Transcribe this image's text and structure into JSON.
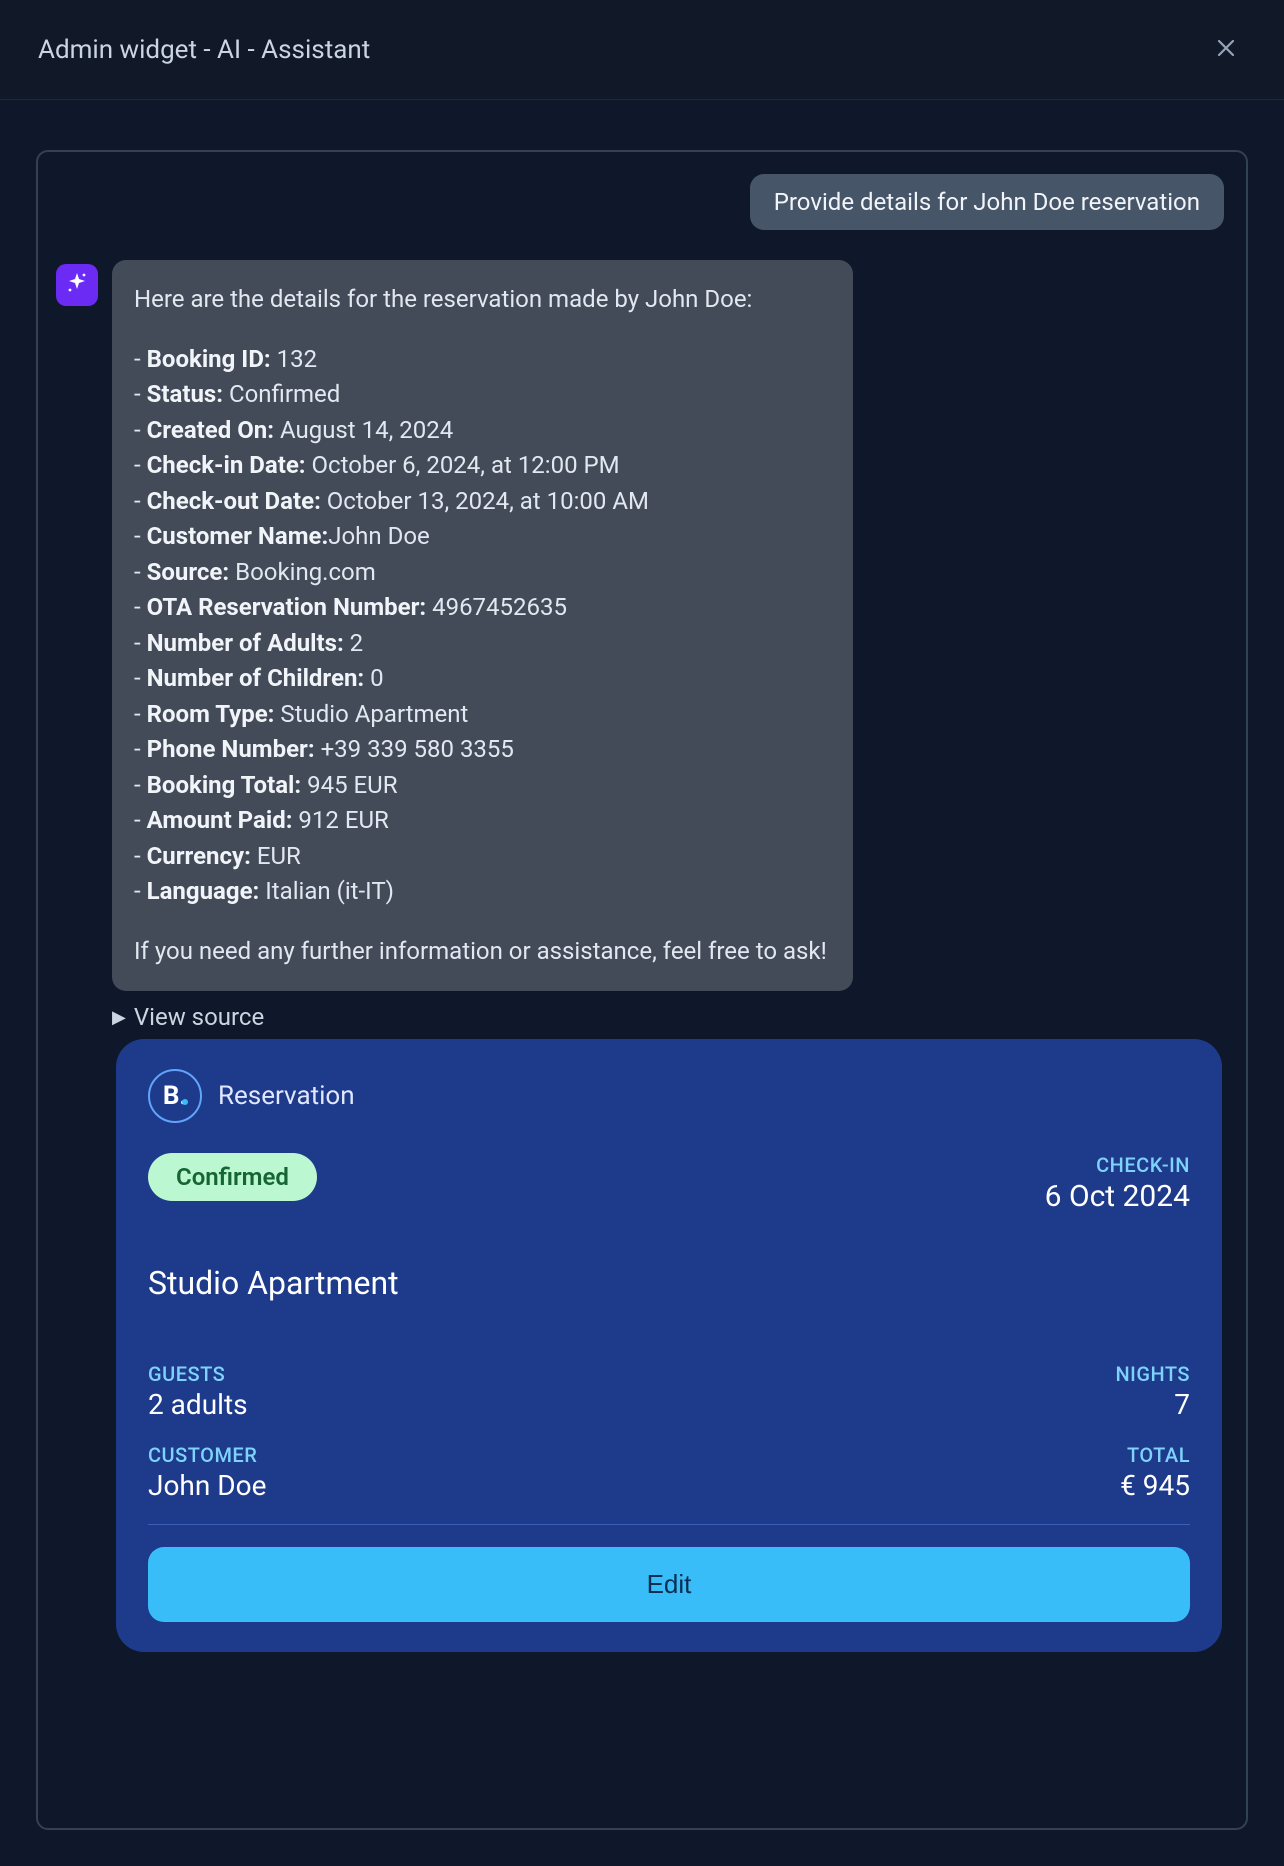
{
  "header": {
    "title": "Admin widget - AI - Assistant"
  },
  "user_message": "Provide details for John Doe reservation",
  "assistant": {
    "intro": "Here are the details for the reservation made by John Doe:",
    "details": [
      {
        "label": "Booking ID:",
        "value": " 132"
      },
      {
        "label": "Status:",
        "value": " Confirmed"
      },
      {
        "label": "Created On:",
        "value": " August 14, 2024"
      },
      {
        "label": "Check-in Date:",
        "value": " October 6, 2024, at 12:00 PM"
      },
      {
        "label": "Check-out Date:",
        "value": " October 13, 2024, at 10:00 AM"
      },
      {
        "label": "Customer Name:",
        "value": "John Doe"
      },
      {
        "label": "Source:",
        "value": " Booking.com"
      },
      {
        "label": "OTA Reservation Number:",
        "value": " 4967452635"
      },
      {
        "label": "Number of Adults:",
        "value": " 2"
      },
      {
        "label": "Number of Children:",
        "value": " 0"
      },
      {
        "label": "Room Type:",
        "value": " Studio Apartment"
      },
      {
        "label": "Phone Number:",
        "value": " +39 339 580 3355"
      },
      {
        "label": "Booking Total:",
        "value": " 945 EUR"
      },
      {
        "label": "Amount Paid:",
        "value": " 912 EUR"
      },
      {
        "label": "Currency:",
        "value": " EUR"
      },
      {
        "label": "Language:",
        "value": " Italian (it-IT)"
      }
    ],
    "outro": "If you need any further information or assistance, feel free to ask!"
  },
  "view_source_label": "View source",
  "reservation_card": {
    "source_logo_letter": "B.",
    "head_label": "Reservation",
    "status": "Confirmed",
    "checkin_label": "CHECK-IN",
    "checkin_value": "6 Oct 2024",
    "room_type": "Studio Apartment",
    "guests_label": "GUESTS",
    "guests_value": "2 adults",
    "nights_label": "NIGHTS",
    "nights_value": "7",
    "customer_label": "CUSTOMER",
    "customer_value": "John Doe",
    "total_label": "TOTAL",
    "total_value": "€ 945",
    "edit_label": "Edit"
  }
}
